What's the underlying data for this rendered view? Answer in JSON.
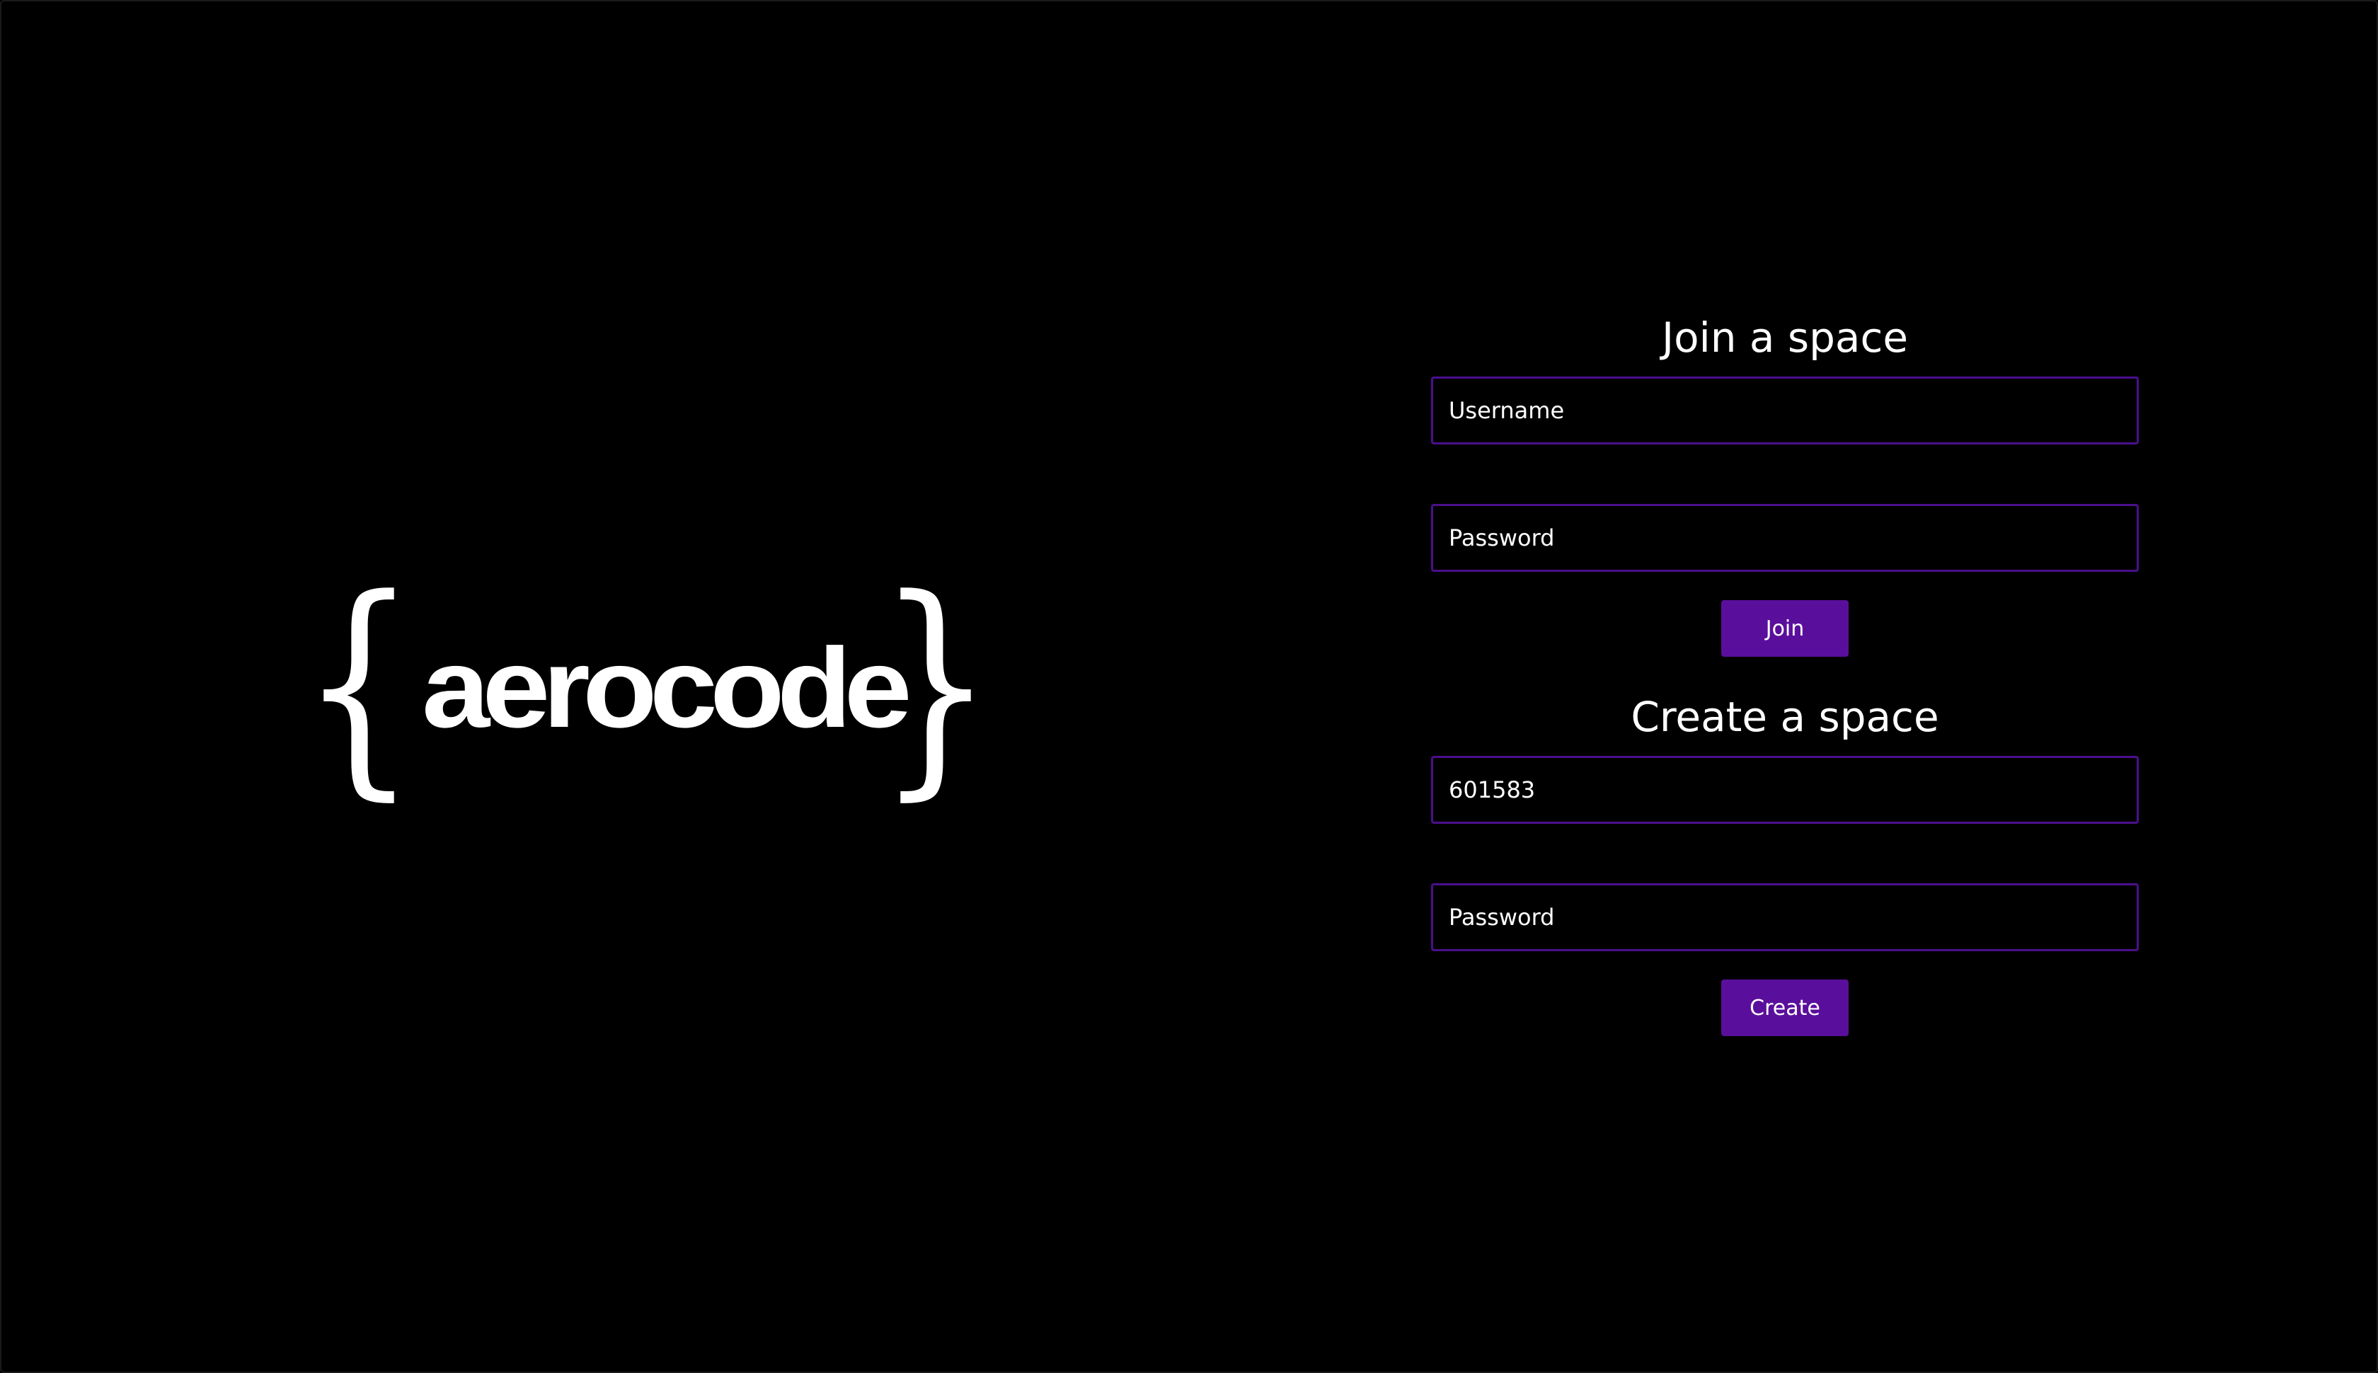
{
  "logo": {
    "open_brace": "{",
    "word": "aerocode",
    "close_brace": "}"
  },
  "join": {
    "title": "Join a space",
    "username_placeholder": "Username",
    "password_placeholder": "Password",
    "button_label": "Join"
  },
  "create": {
    "title": "Create a space",
    "space_id_value": "601583",
    "password_placeholder": "Password",
    "button_label": "Create"
  },
  "colors": {
    "background": "#000000",
    "accent": "#5a0f9c",
    "field_border": "#4b0f8c",
    "text": "#ffffff"
  }
}
